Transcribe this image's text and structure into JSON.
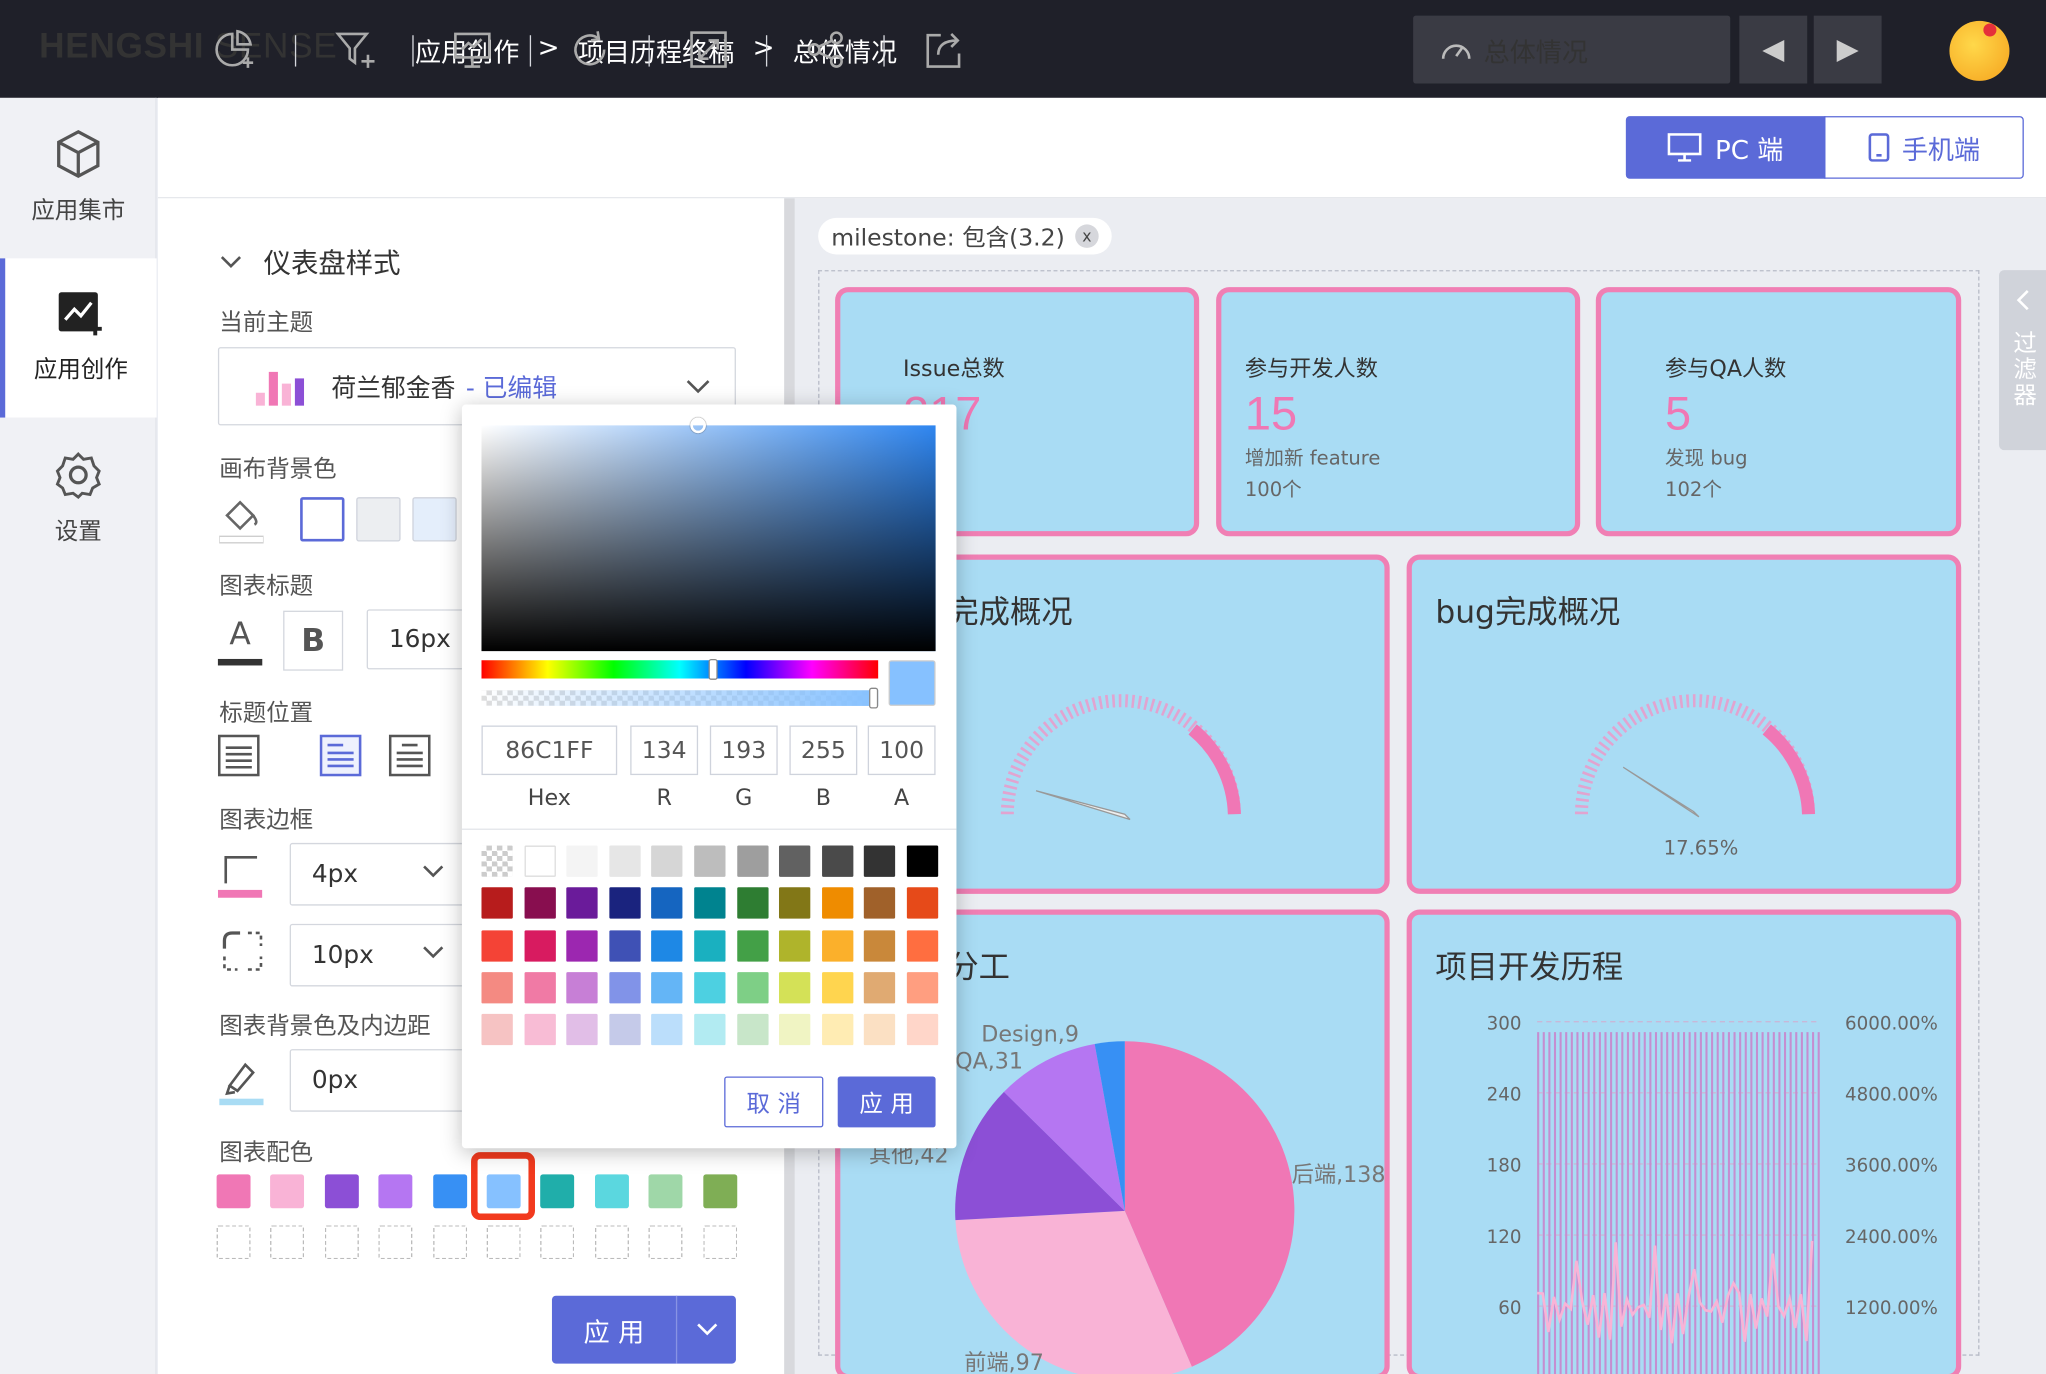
{
  "app": {
    "logo_bold": "HENGSHI",
    "logo_light": " SENSE"
  },
  "breadcrumb": [
    "应用创作",
    ">",
    "项目历程终稿",
    ">",
    "总体情况"
  ],
  "page_selector": {
    "label": "总体情况"
  },
  "left_nav": [
    {
      "label": "应用集市",
      "icon": "cube-icon"
    },
    {
      "label": "应用创作",
      "icon": "chart-add-icon",
      "active": true
    },
    {
      "label": "设置",
      "icon": "gear-icon"
    }
  ],
  "toolbar": {
    "pc_label": "PC 端",
    "mobile_label": "手机端"
  },
  "settings": {
    "section_title": "仪表盘样式",
    "theme_label": "当前主题",
    "theme_name": "荷兰郁金香",
    "theme_edited": "- 已编辑",
    "canvas_bg_label": "画布背景色",
    "chart_title_label": "图表标题",
    "font_bold": "B",
    "font_letter": "A",
    "font_size": "16px",
    "title_pos_label": "标题位置",
    "border_label": "图表边框",
    "border_width": "4px",
    "border_radius": "10px",
    "bg_padding_label": "图表背景色及内边距",
    "padding": "0px",
    "palette_label": "图表配色",
    "palette": [
      "#f077b5",
      "#f9b3d6",
      "#8c4fd6",
      "#b576f2",
      "#3790f4",
      "#86c1ff",
      "#20aeaa",
      "#5bd7df",
      "#9fd7a8",
      "#7fae55"
    ],
    "apply_label": "应 用"
  },
  "filter_chip": {
    "label": "milestone: 包含(3.2)",
    "close": "x"
  },
  "side_tab": {
    "label": "过滤器"
  },
  "kpis": [
    {
      "title": "Issue总数",
      "value": "217",
      "sub1": "",
      "sub2": ""
    },
    {
      "title": "参与开发人数",
      "value": "15",
      "sub1": "增加新 feature",
      "sub2": "100个"
    },
    {
      "title": "参与QA人数",
      "value": "5",
      "sub1": "发现 bug",
      "sub2": "102个"
    }
  ],
  "cards": {
    "feature_title": "完成概况",
    "bug_title": "bug完成概况",
    "bug_gauge_value": "17.65%",
    "division_title": "分工",
    "history_title": "项目开发历程"
  },
  "chart_data": [
    {
      "type": "pie",
      "title": "分工",
      "labels": [
        "后端",
        "前端",
        "其他",
        "QA",
        "Design"
      ],
      "values": [
        138,
        97,
        42,
        31,
        9
      ],
      "data_labels": [
        "后端,138",
        "前端,97",
        "其他,42",
        "QA,31",
        "Design,9"
      ],
      "colors": [
        "#f077b5",
        "#f9b3d6",
        "#8c4fd6",
        "#b576f2",
        "#3790f4"
      ]
    },
    {
      "type": "bar",
      "title": "项目开发历程",
      "y_ticks_left": [
        "300",
        "240",
        "180",
        "120",
        "60"
      ],
      "y_ticks_right": [
        "6000.00%",
        "4800.00%",
        "3600.00%",
        "2400.00%",
        "1200.00%"
      ],
      "ylim": [
        0,
        300
      ]
    }
  ],
  "color_picker": {
    "hex": "86C1FF",
    "r": "134",
    "g": "193",
    "b": "255",
    "a": "100",
    "labels": [
      "Hex",
      "R",
      "G",
      "B",
      "A"
    ],
    "cancel": "取 消",
    "ok": "应 用",
    "preset_rows": [
      [
        "checker",
        "#ffffff",
        "#f4f4f4",
        "#e6e6e6",
        "#d6d6d6",
        "#bdbdbd",
        "#9e9e9e",
        "#616161",
        "#4a4a4a",
        "#333333",
        "#000000"
      ],
      [
        "#b71c1c",
        "#880e4f",
        "#6a1b9a",
        "#1a237e",
        "#1565c0",
        "#00838f",
        "#2e7d32",
        "#827717",
        "#ef8c00",
        "#a0612a",
        "#e64a19"
      ],
      [
        "#f44336",
        "#d81b60",
        "#9c27b0",
        "#3f51b5",
        "#1e88e5",
        "#1ab0c0",
        "#43a047",
        "#afb42b",
        "#fbb02b",
        "#c9883a",
        "#ff6e40"
      ],
      [
        "#f48a82",
        "#f07aa5",
        "#c77fd6",
        "#8193e8",
        "#64b5f6",
        "#4dd0e1",
        "#7ecf86",
        "#d4e157",
        "#ffd54f",
        "#e0aa72",
        "#ff9e80"
      ],
      [
        "#f6c3c3",
        "#f8bcd5",
        "#e1bee7",
        "#c5cae9",
        "#bbdefb",
        "#b2ebf2",
        "#c8e6c9",
        "#f0f4c3",
        "#ffecb3",
        "#fbe0c3",
        "#ffd6c9"
      ]
    ]
  }
}
